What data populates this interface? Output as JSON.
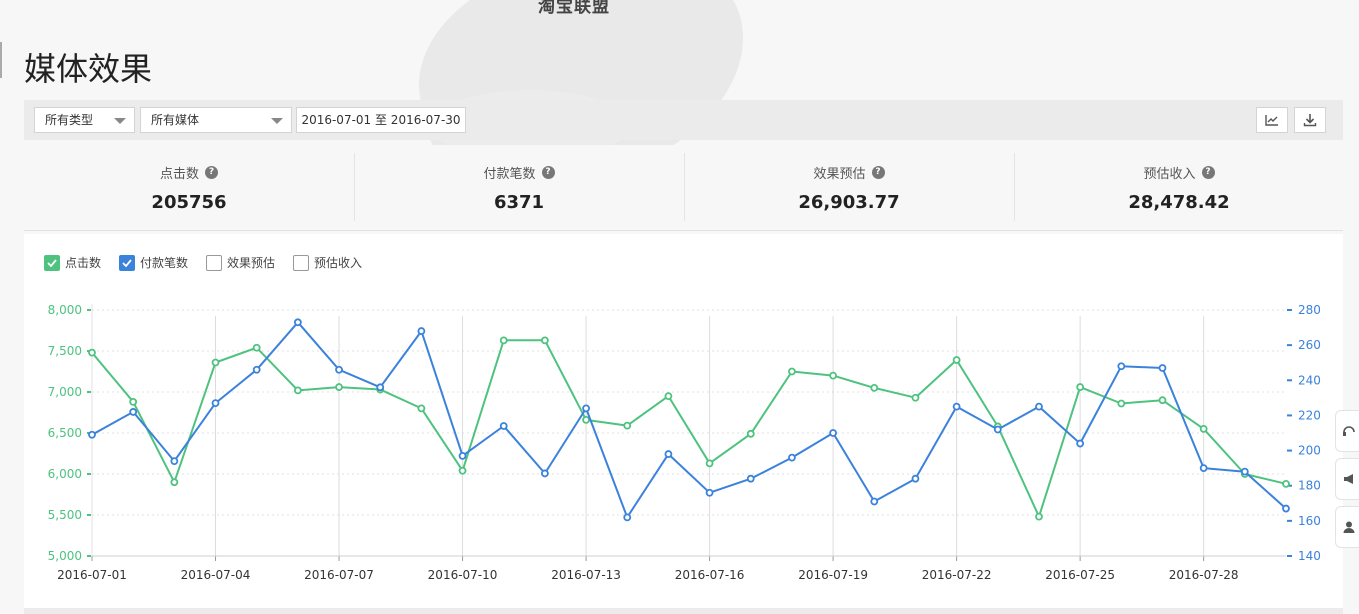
{
  "page": {
    "top_fragment": "淘宝联盟",
    "title": "媒体效果"
  },
  "filters": {
    "type_select": "所有类型",
    "media_select": "所有媒体",
    "date_range": "2016-07-01 至 2016-07-30"
  },
  "toolbar": {
    "chart_icon": "line-chart-icon",
    "download_icon": "download-icon"
  },
  "stats": [
    {
      "label": "点击数",
      "value": "205756"
    },
    {
      "label": "付款笔数",
      "value": "6371"
    },
    {
      "label": "效果预估",
      "value": "26,903.77"
    },
    {
      "label": "预估收入",
      "value": "28,478.42"
    }
  ],
  "legend": [
    {
      "label": "点击数",
      "checked": true,
      "color": "#4ec27f"
    },
    {
      "label": "付款笔数",
      "checked": true,
      "color": "#3b82db"
    },
    {
      "label": "效果预估",
      "checked": false
    },
    {
      "label": "预估收入",
      "checked": false
    }
  ],
  "chart_data": {
    "type": "line",
    "x": [
      "2016-07-01",
      "2016-07-02",
      "2016-07-03",
      "2016-07-04",
      "2016-07-05",
      "2016-07-06",
      "2016-07-07",
      "2016-07-08",
      "2016-07-09",
      "2016-07-10",
      "2016-07-11",
      "2016-07-12",
      "2016-07-13",
      "2016-07-14",
      "2016-07-15",
      "2016-07-16",
      "2016-07-17",
      "2016-07-18",
      "2016-07-19",
      "2016-07-20",
      "2016-07-21",
      "2016-07-22",
      "2016-07-23",
      "2016-07-24",
      "2016-07-25",
      "2016-07-26",
      "2016-07-27",
      "2016-07-28",
      "2016-07-29",
      "2016-07-30"
    ],
    "x_tick_labels": [
      "2016-07-01",
      "2016-07-04",
      "2016-07-07",
      "2016-07-10",
      "2016-07-13",
      "2016-07-16",
      "2016-07-19",
      "2016-07-22",
      "2016-07-25",
      "2016-07-28"
    ],
    "y_left": {
      "ticks": [
        "5,000",
        "5,500",
        "6,000",
        "6,500",
        "7,000",
        "7,500",
        "8,000"
      ],
      "ylim": [
        5000,
        8000
      ],
      "color": "#4ec27f"
    },
    "y_right": {
      "ticks": [
        "140",
        "160",
        "180",
        "200",
        "220",
        "240",
        "260",
        "280"
      ],
      "ylim": [
        140,
        280
      ],
      "color": "#3b82db"
    },
    "grid": true,
    "series": [
      {
        "name": "点击数",
        "axis": "left",
        "color": "#4ec27f",
        "values": [
          7480,
          6880,
          5900,
          7360,
          7540,
          7020,
          7060,
          7030,
          6800,
          6040,
          7630,
          7630,
          6660,
          6590,
          6950,
          6130,
          6490,
          7250,
          7200,
          7050,
          6930,
          7390,
          6580,
          5480,
          7060,
          6860,
          6900,
          6550,
          6000,
          5880
        ]
      },
      {
        "name": "付款笔数",
        "axis": "right",
        "color": "#3b82db",
        "values": [
          209,
          222,
          194,
          227,
          246,
          273,
          246,
          236,
          268,
          197,
          214,
          187,
          224,
          162,
          198,
          176,
          184,
          196,
          210,
          171,
          184,
          225,
          212,
          225,
          204,
          248,
          247,
          190,
          188,
          167
        ]
      }
    ]
  }
}
